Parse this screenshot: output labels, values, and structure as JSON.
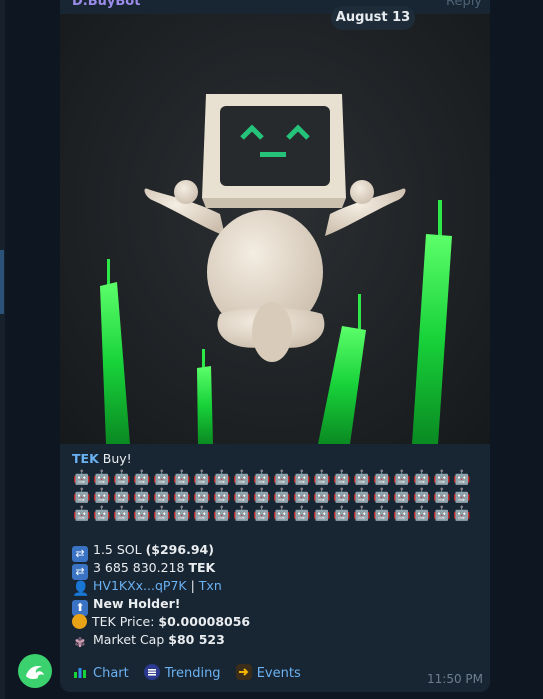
{
  "message": {
    "sender": "D.BuyBot",
    "reply_label": "Reply",
    "date_badge": "August 13",
    "title_token": "TEK",
    "title_rest": " Buy!",
    "emoji_count": 60,
    "emoji_name": "robot-face-icon",
    "sol_amount": "1.5 SOL",
    "sol_usd": "($296.94)",
    "tek_amount_num": "3 685 830.218",
    "tek_amount_token": "TEK",
    "wallet": "HV1KXx...qP7K",
    "separator": " | ",
    "txn_label": "Txn",
    "new_holder": "New Holder!",
    "price_label": "TEK Price:",
    "price_value": "$0.00008056",
    "mcap_label": "Market Cap",
    "mcap_value": "$80 523",
    "time": "11:50 PM"
  },
  "buttons": {
    "chart": "Chart",
    "trending": "Trending",
    "events": "Events"
  },
  "colors": {
    "chat_bg": "#0e1621",
    "bubble_bg": "#182533",
    "link": "#6ab2f2",
    "sender": "#9a8ce8",
    "candle_green": "#18d23a",
    "fab_green": "#3bd16f"
  }
}
